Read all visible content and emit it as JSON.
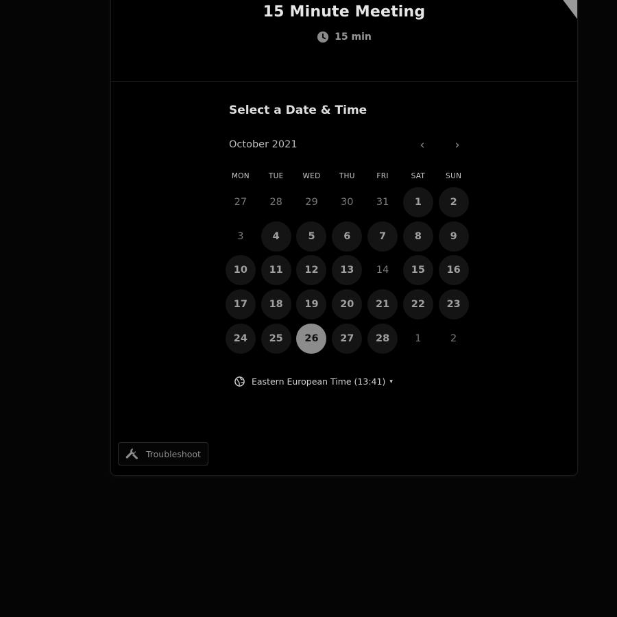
{
  "event": {
    "title": "15 Minute Meeting",
    "duration": "15 min",
    "duration_icon": "clock-icon"
  },
  "picker": {
    "section_title": "Select a Date & Time",
    "month": "October 2021",
    "prev_icon": "chevron-left-icon",
    "next_icon": "chevron-right-icon",
    "prev_glyph": "‹",
    "next_glyph": "›",
    "weekdays": [
      "MON",
      "TUE",
      "WED",
      "THU",
      "FRI",
      "SAT",
      "SUN"
    ],
    "days": [
      {
        "label": "27",
        "state": "unavailable"
      },
      {
        "label": "28",
        "state": "unavailable"
      },
      {
        "label": "29",
        "state": "unavailable"
      },
      {
        "label": "30",
        "state": "unavailable"
      },
      {
        "label": "31",
        "state": "unavailable"
      },
      {
        "label": "1",
        "state": "available"
      },
      {
        "label": "2",
        "state": "available"
      },
      {
        "label": "3",
        "state": "unavailable"
      },
      {
        "label": "4",
        "state": "available"
      },
      {
        "label": "5",
        "state": "available"
      },
      {
        "label": "6",
        "state": "available"
      },
      {
        "label": "7",
        "state": "available"
      },
      {
        "label": "8",
        "state": "available"
      },
      {
        "label": "9",
        "state": "available"
      },
      {
        "label": "10",
        "state": "available"
      },
      {
        "label": "11",
        "state": "available"
      },
      {
        "label": "12",
        "state": "available"
      },
      {
        "label": "13",
        "state": "available"
      },
      {
        "label": "14",
        "state": "unavailable"
      },
      {
        "label": "15",
        "state": "available"
      },
      {
        "label": "16",
        "state": "available"
      },
      {
        "label": "17",
        "state": "available"
      },
      {
        "label": "18",
        "state": "available"
      },
      {
        "label": "19",
        "state": "available"
      },
      {
        "label": "20",
        "state": "available"
      },
      {
        "label": "21",
        "state": "available"
      },
      {
        "label": "22",
        "state": "available"
      },
      {
        "label": "23",
        "state": "available"
      },
      {
        "label": "24",
        "state": "available"
      },
      {
        "label": "25",
        "state": "available"
      },
      {
        "label": "26",
        "state": "selected"
      },
      {
        "label": "27",
        "state": "available"
      },
      {
        "label": "28",
        "state": "available"
      },
      {
        "label": "1",
        "state": "unavailable"
      },
      {
        "label": "2",
        "state": "unavailable"
      }
    ],
    "timezone": {
      "label": "Eastern European Time (13:41)",
      "icon": "globe-icon",
      "caret": "▾"
    }
  },
  "footer": {
    "troubleshoot_label": "Troubleshoot",
    "troubleshoot_icon": "wrench-icon"
  },
  "colors": {
    "background": "#000000",
    "available_day_bg": "#141414",
    "selected_day_bg": "#8c8c8c",
    "corner_ribbon": "#9a9a9a"
  }
}
